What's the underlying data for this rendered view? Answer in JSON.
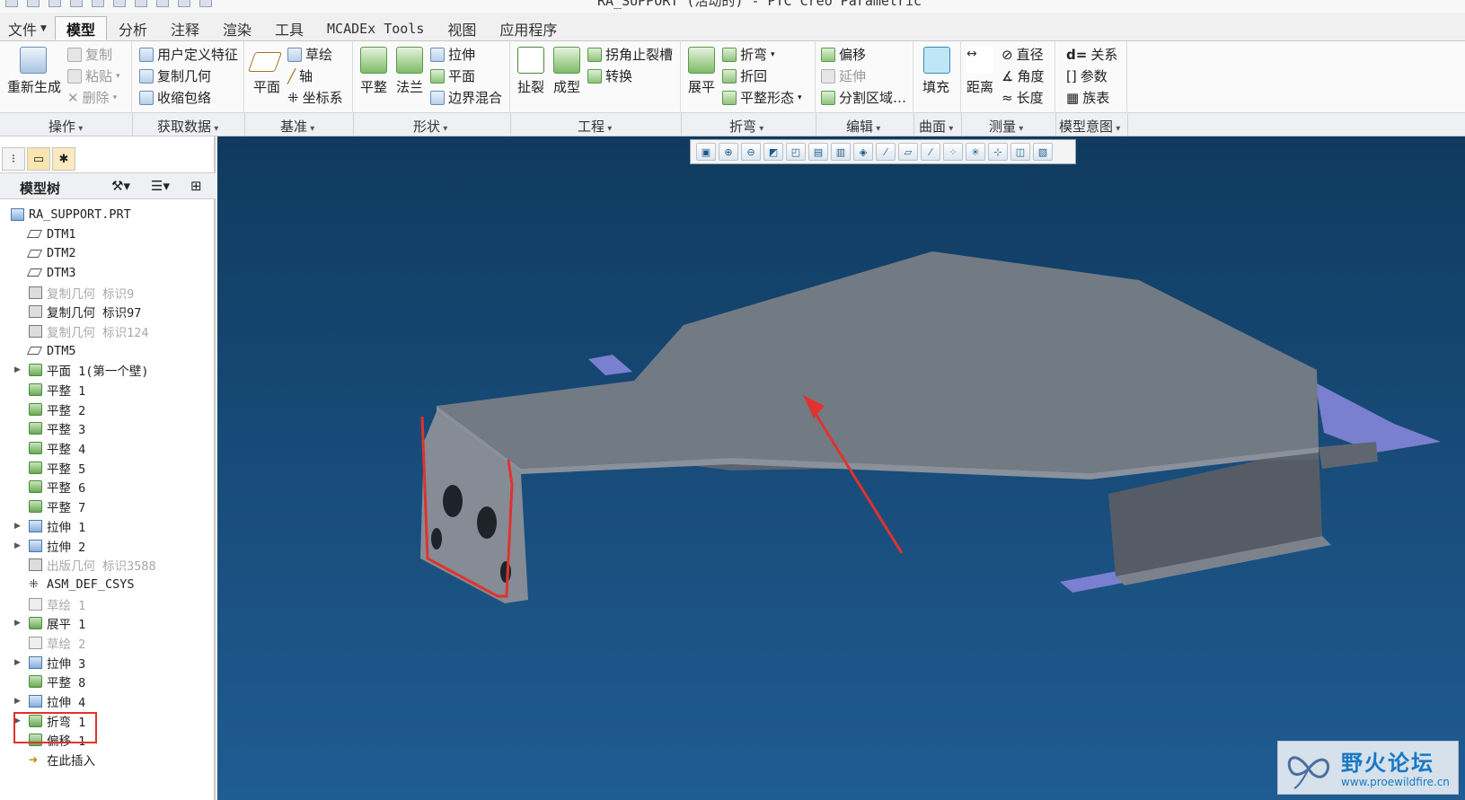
{
  "window": {
    "title": "RA_SUPPORT (活动的) - PTC Creo Parametric"
  },
  "menu": {
    "tabs": [
      {
        "label": "文件",
        "dropdown": true
      },
      {
        "label": "模型",
        "active": true
      },
      {
        "label": "分析"
      },
      {
        "label": "注释"
      },
      {
        "label": "渲染"
      },
      {
        "label": "工具"
      },
      {
        "label": "MCADEx Tools"
      },
      {
        "label": "视图"
      },
      {
        "label": "应用程序"
      }
    ]
  },
  "ribbon": {
    "ops": {
      "regen": "重新生成",
      "copy": "复制",
      "paste": "粘贴",
      "delete": "删除"
    },
    "getdata": {
      "udf": "用户定义特征",
      "copygeom": "复制几何",
      "shrinkwrap": "收缩包络"
    },
    "datum": {
      "plane": "平面",
      "sketch": "草绘",
      "axis": "轴",
      "csys": "坐标系"
    },
    "shapes": {
      "flat": "平整",
      "flange": "法兰",
      "extrude": "拉伸",
      "planar": "平面",
      "blend": "边界混合"
    },
    "eng": {
      "rip": "扯裂",
      "form": "成型",
      "corner_relief": "拐角止裂槽",
      "convert": "转换"
    },
    "bend": {
      "unbend": "展平",
      "bend": "折弯",
      "bendback": "折回",
      "flat_state": "平整形态"
    },
    "edit": {
      "offset": "偏移",
      "extend": "延伸",
      "split": "分割区域…"
    },
    "surface": {
      "fill": "填充"
    },
    "measure": {
      "distance": "距离",
      "diameter": "直径",
      "angle": "角度",
      "length": "长度"
    },
    "intent": {
      "relations": "关系",
      "params": "参数",
      "family": "族表"
    }
  },
  "groups": {
    "ops": "操作",
    "getdata": "获取数据",
    "datum": "基准",
    "shapes": "形状",
    "eng": "工程",
    "bend": "折弯",
    "edit": "编辑",
    "surface": "曲面",
    "measure": "测量",
    "intent": "模型意图"
  },
  "model_tree": {
    "header": "模型树",
    "items": [
      {
        "label": "RA_SUPPORT.PRT",
        "icon": "part-icon",
        "level": 0
      },
      {
        "label": "DTM1",
        "icon": "datum-plane-icon"
      },
      {
        "label": "DTM2",
        "icon": "datum-plane-icon"
      },
      {
        "label": "DTM3",
        "icon": "datum-plane-icon"
      },
      {
        "label": "复制几何 标识9",
        "icon": "copy-geom-icon",
        "dim": true
      },
      {
        "label": "复制几何 标识97",
        "icon": "copy-geom-icon"
      },
      {
        "label": "复制几何 标识124",
        "icon": "copy-geom-icon",
        "dim": true
      },
      {
        "label": "DTM5",
        "icon": "datum-plane-icon"
      },
      {
        "label": "平面 1(第一个壁)",
        "icon": "wall-icon",
        "expand": true
      },
      {
        "label": "平整 1",
        "icon": "flat-wall-icon"
      },
      {
        "label": "平整 2",
        "icon": "flat-wall-icon"
      },
      {
        "label": "平整 3",
        "icon": "flat-wall-icon"
      },
      {
        "label": "平整 4",
        "icon": "flat-wall-icon"
      },
      {
        "label": "平整 5",
        "icon": "flat-wall-icon"
      },
      {
        "label": "平整 6",
        "icon": "flat-wall-icon"
      },
      {
        "label": "平整 7",
        "icon": "flat-wall-icon"
      },
      {
        "label": "拉伸 1",
        "icon": "extrude-icon",
        "expand": true
      },
      {
        "label": "拉伸 2",
        "icon": "extrude-icon",
        "expand": true
      },
      {
        "label": "出版几何 标识3588",
        "icon": "publish-geom-icon",
        "dim": true
      },
      {
        "label": "ASM_DEF_CSYS",
        "icon": "csys-icon"
      },
      {
        "label": "草绘 1",
        "icon": "sketch-icon",
        "dim": true
      },
      {
        "label": "展平 1",
        "icon": "unbend-icon",
        "expand": true
      },
      {
        "label": "草绘 2",
        "icon": "sketch-icon",
        "dim": true
      },
      {
        "label": "拉伸 3",
        "icon": "extrude-icon",
        "expand": true
      },
      {
        "label": "平整 8",
        "icon": "flat-wall-icon"
      },
      {
        "label": "拉伸 4",
        "icon": "extrude-icon",
        "expand": true
      },
      {
        "label": "折弯 1",
        "icon": "bend-icon",
        "expand": true
      },
      {
        "label": "偏移 1",
        "icon": "offset-icon"
      },
      {
        "label": "在此插入",
        "icon": "insert-here-icon"
      }
    ]
  },
  "watermark": {
    "text": "野火论坛",
    "url": "www.proewildfire.cn"
  },
  "colors": {
    "viewport_top": "#0f3a5e",
    "viewport_bottom": "#1f5c92",
    "part": "#6b727c",
    "highlight": "#e0322f",
    "datum_plane": "#7a7fd0"
  }
}
